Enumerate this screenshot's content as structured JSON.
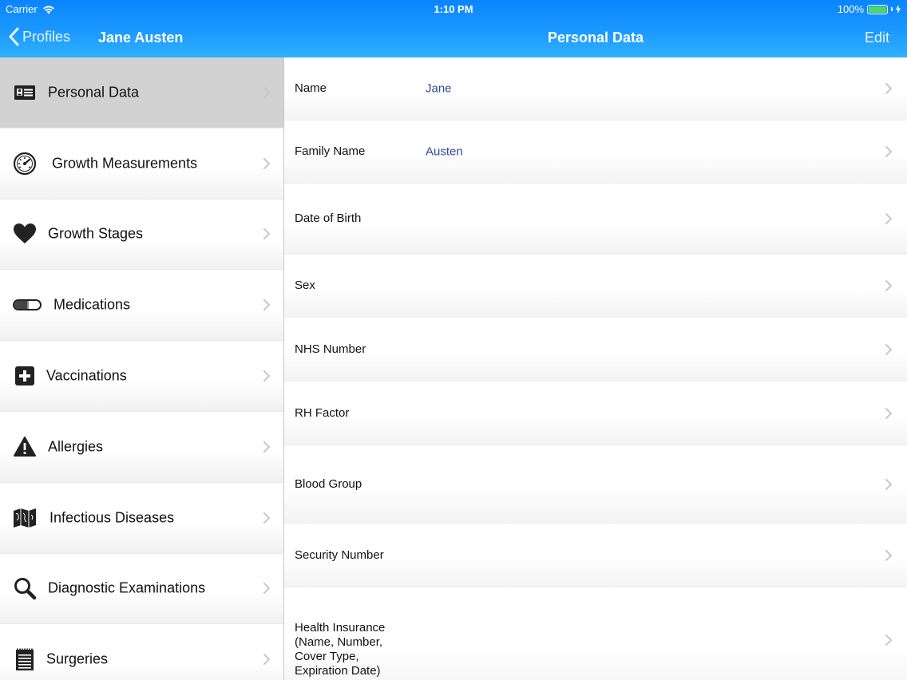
{
  "status": {
    "carrier": "Carrier",
    "time": "1:10 PM",
    "battery": "100%"
  },
  "nav": {
    "back_label": "Profiles",
    "profile_name": "Jane Austen",
    "detail_title": "Personal Data",
    "edit_label": "Edit"
  },
  "colors": {
    "accent": "#0a84ff",
    "selected": "#d2d2d2",
    "value_text": "#2f4a9a"
  },
  "sidebar": {
    "items": [
      {
        "label": "Personal Data",
        "icon": "id-card-icon",
        "selected": true
      },
      {
        "label": "Growth Measurements",
        "icon": "gauge-icon"
      },
      {
        "label": "Growth Stages",
        "icon": "heart-icon"
      },
      {
        "label": "Medications",
        "icon": "pill-icon"
      },
      {
        "label": "Vaccinations",
        "icon": "plus-square-icon"
      },
      {
        "label": "Allergies",
        "icon": "warning-icon"
      },
      {
        "label": "Infectious Diseases",
        "icon": "map-icon"
      },
      {
        "label": "Diagnostic Examinations",
        "icon": "magnifier-icon"
      },
      {
        "label": "Surgeries",
        "icon": "notepad-icon"
      }
    ]
  },
  "fields": [
    {
      "label": "Name",
      "value": "Jane"
    },
    {
      "label": "Family Name",
      "value": "Austen"
    },
    {
      "label": "Date of Birth",
      "value": ""
    },
    {
      "label": "Sex",
      "value": ""
    },
    {
      "label": "NHS Number",
      "value": ""
    },
    {
      "label": "RH Factor",
      "value": ""
    },
    {
      "label": "Blood Group",
      "value": ""
    },
    {
      "label": "Security Number",
      "value": ""
    },
    {
      "label": "Health Insurance (Name, Number, Cover Type, Expiration Date)",
      "value": ""
    }
  ]
}
